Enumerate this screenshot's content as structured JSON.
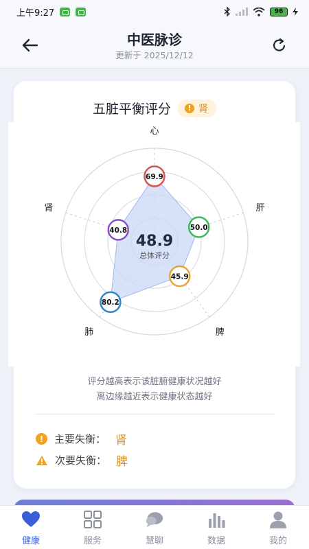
{
  "status_bar": {
    "time": "上午9:27",
    "battery": "96"
  },
  "nav": {
    "title": "中医脉诊",
    "subtitle": "更新于 2025/12/12"
  },
  "card": {
    "title": "五脏平衡评分",
    "tag_label": "肾",
    "tag_color": "#d9911b",
    "notes": [
      "评分越高表示该脏腑健康状况越好",
      "离边缘越近表示健康状态越好"
    ],
    "primary_label": "主要失衡：",
    "primary_value": "肾",
    "secondary_label": "次要失衡：",
    "secondary_value": "脾"
  },
  "chart_data": {
    "type": "radar",
    "total_score": "48.9",
    "total_label": "总体评分",
    "axis_max": 100,
    "rings": 4,
    "axes": [
      {
        "label": "心",
        "value": 69.9,
        "display": "69.9",
        "color": "#d9534f"
      },
      {
        "label": "肝",
        "value": 50.0,
        "display": "50.0",
        "color": "#3cb95a"
      },
      {
        "label": "脾",
        "value": 45.9,
        "display": "45.9",
        "color": "#e8a23a"
      },
      {
        "label": "肺",
        "value": 80.2,
        "display": "80.2",
        "color": "#2e86c9"
      },
      {
        "label": "肾",
        "value": 40.8,
        "display": "40.8",
        "color": "#8a4fc8"
      }
    ],
    "fill_color": "#c9d8f7",
    "stroke_color": "#9db8ef"
  },
  "tabs": [
    {
      "label": "健康",
      "icon": "heart-icon",
      "active": true
    },
    {
      "label": "服务",
      "icon": "grid-icon",
      "active": false
    },
    {
      "label": "慧聊",
      "icon": "chat-icon",
      "active": false
    },
    {
      "label": "数据",
      "icon": "bar-chart-icon",
      "active": false
    },
    {
      "label": "我的",
      "icon": "user-icon",
      "active": false
    }
  ],
  "colors": {
    "accent": "#3b5fd9",
    "warning": "#f0a31e"
  }
}
